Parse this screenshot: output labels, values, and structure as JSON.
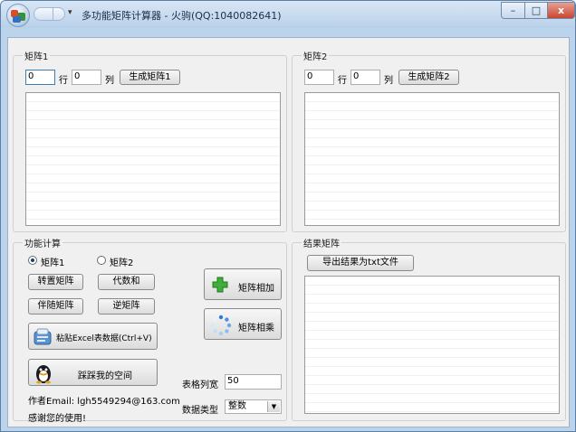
{
  "window": {
    "title": "多功能矩阵计算器 - 火驹(QQ:1040082641)",
    "controls": {
      "minimize": "–",
      "maximize": "□",
      "close": "x"
    },
    "quick_access_arrow": "▾"
  },
  "matrix1": {
    "legend": "矩阵1",
    "rows_value": "0",
    "rows_label": "行",
    "cols_value": "0",
    "cols_label": "列",
    "generate_label": "生成矩阵1"
  },
  "matrix2": {
    "legend": "矩阵2",
    "rows_value": "0",
    "rows_label": "行",
    "cols_value": "0",
    "cols_label": "列",
    "generate_label": "生成矩阵2"
  },
  "functions": {
    "legend": "功能计算",
    "radio1_label": "矩阵1",
    "radio2_label": "矩阵2",
    "selected": "矩阵1",
    "transpose_label": "转置矩阵",
    "cofactor_label": "代数和",
    "adjoint_label": "伴随矩阵",
    "inverse_label": "逆矩阵",
    "paste_excel_label": "粘贴Excel表数据(Ctrl+V)",
    "visit_space_label": "踩踩我的空间",
    "add_label": "矩阵相加",
    "multiply_label": "矩阵相乘",
    "col_width_label": "表格列宽",
    "col_width_value": "50",
    "data_type_label": "数据类型",
    "data_type_value": "整数",
    "author_email": "作者Email: lgh5549294@163.com",
    "thanks": "感谢您的使用!"
  },
  "result": {
    "legend": "结果矩阵",
    "export_label": "导出结果为txt文件"
  },
  "icons": {
    "app": "app-orb-icon",
    "paste": "paste-clipboard-icon",
    "qq": "qq-penguin-icon",
    "add": "green-plus-icon",
    "multiply": "spinner-icon"
  }
}
